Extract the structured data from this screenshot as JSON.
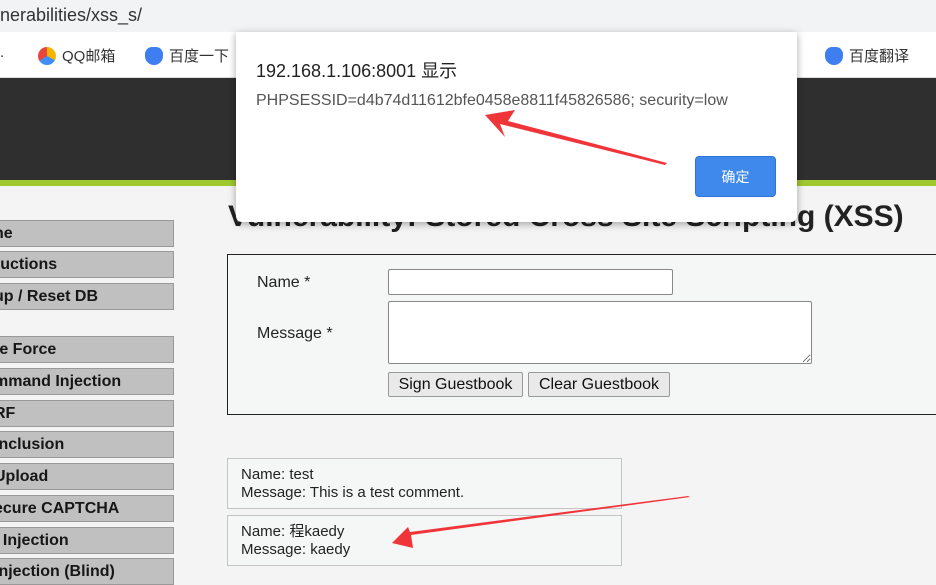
{
  "browser": {
    "address": "nerabilities/xss_s/",
    "bookmarks": [
      {
        "label": "QQ邮箱",
        "icon": "qq-mail-icon"
      },
      {
        "label": "百度一下",
        "icon": "baidu-paw-icon"
      },
      {
        "label": "百度翻译",
        "icon": "baidu-paw-icon"
      }
    ]
  },
  "sidebar": {
    "items": [
      "ne",
      "ructions",
      "up / Reset DB",
      "te Force",
      "mmand Injection",
      "RF",
      " Inclusion",
      " Upload",
      "ecure CAPTCHA",
      ". Injection",
      " Injection (Blind)"
    ]
  },
  "main": {
    "title": "Vulnerability: Stored Cross Site Scripting (XSS)",
    "form": {
      "name_label": "Name *",
      "message_label": "Message *",
      "name_value": "",
      "message_value": "",
      "sign_button": "Sign Guestbook",
      "clear_button": "Clear Guestbook"
    },
    "entries": [
      {
        "name": "Name: test",
        "message": "Message: This is a test comment."
      },
      {
        "name": "Name: 程kaedy",
        "message": "Message: kaedy"
      }
    ]
  },
  "dialog": {
    "title": "192.168.1.106:8001 显示",
    "message": "PHPSESSID=d4b74d11612bfe0458e8811f45826586; security=low",
    "ok_button": "确定"
  },
  "colors": {
    "accent": "#3f89ec",
    "header": "#2f2f2f",
    "green_bar": "#9fc92f",
    "annotation_arrow": "#f0353a"
  }
}
